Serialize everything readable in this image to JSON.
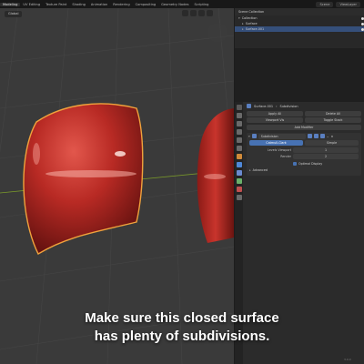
{
  "topbar": {
    "workspaces": [
      "Modeling",
      "UV Editing",
      "Texture Paint",
      "Shading",
      "Animation",
      "Rendering",
      "Compositing",
      "Geometry Nodes",
      "Scripting"
    ],
    "active_workspace": "Modeling",
    "scene": "Scene",
    "view_layer": "ViewLayer"
  },
  "viewport": {
    "shading_dropdown": "Global",
    "colors": {
      "background": "#3a3a3a",
      "grid": "#444444",
      "surface": "#c1322c",
      "surface_highlight": "#f28a80",
      "selection_outline": "#f0a23c"
    }
  },
  "outliner": {
    "title": "Scene Collection",
    "rows": [
      {
        "label": "Collection",
        "selected": false
      },
      {
        "label": "Surface",
        "selected": false
      },
      {
        "label": "Surface.001",
        "selected": true
      }
    ]
  },
  "properties": {
    "breadcrumb_object": "Surface.001",
    "breadcrumb_modifier": "Subdivision",
    "rows": [
      {
        "left": "Apply All",
        "right": "Delete All"
      },
      {
        "left": "Viewport Vis",
        "right": "Toggle Stack"
      }
    ],
    "add_modifier": "Add Modifier",
    "modifier": {
      "name": "Subdivision",
      "modes": [
        "Catmull-Clark",
        "Simple"
      ],
      "active_mode": "Catmull-Clark",
      "levels_viewport_label": "Levels Viewport",
      "levels_viewport_value": "1",
      "render_label": "Render",
      "render_value": "2",
      "optimal_display_label": "Optimal Display",
      "optimal_display_checked": true,
      "advanced_label": "Advanced"
    }
  },
  "caption": {
    "line1": "Make sure this closed surface",
    "line2": "has plenty of subdivisions."
  },
  "version": "3.0.0"
}
